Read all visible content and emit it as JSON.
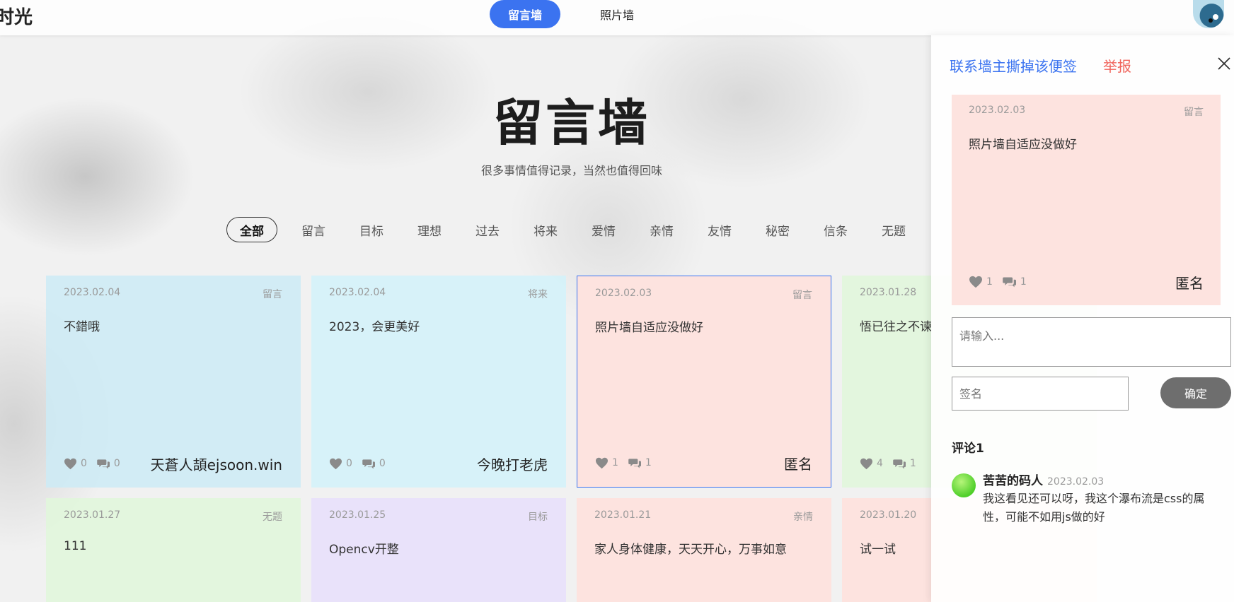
{
  "app": {
    "logo_text": "时光"
  },
  "nav": {
    "items": [
      {
        "label": "留言墙",
        "active": true
      },
      {
        "label": "照片墙",
        "active": false
      }
    ]
  },
  "hero": {
    "title": "留言墙",
    "subtitle": "很多事情值得记录，当然也值得回味"
  },
  "filters": {
    "selected": "全部",
    "items": [
      "全部",
      "留言",
      "目标",
      "理想",
      "过去",
      "将来",
      "爱情",
      "亲情",
      "友情",
      "秘密",
      "信条",
      "无题"
    ]
  },
  "cards": [
    {
      "date": "2023.02.04",
      "category": "留言",
      "message": "不錯哦",
      "likes": "0",
      "comments": "0",
      "signer": "天蒼人頡ejsoon.win",
      "color": "blue"
    },
    {
      "date": "2023.02.04",
      "category": "将来",
      "message": "2023，会更美好",
      "likes": "0",
      "comments": "0",
      "signer": "今晚打老虎",
      "color": "cyan"
    },
    {
      "date": "2023.02.03",
      "category": "留言",
      "message": "照片墙自适应没做好",
      "likes": "1",
      "comments": "1",
      "signer": "匿名",
      "color": "pink",
      "selected": true
    },
    {
      "date": "2023.01.28",
      "category": "",
      "message": "悟已往之不谏",
      "likes": "4",
      "comments": "1",
      "signer": "",
      "color": "green"
    },
    {
      "date": "2023.01.27",
      "category": "无题",
      "message": "111",
      "color": "green"
    },
    {
      "date": "2023.01.25",
      "category": "目标",
      "message": "Opencv开整",
      "color": "purple"
    },
    {
      "date": "2023.01.21",
      "category": "亲情",
      "message": "家人身体健康，天天开心，万事如意",
      "color": "pink"
    },
    {
      "date": "2023.01.20",
      "category": "",
      "message": "试一试",
      "color": "pink"
    }
  ],
  "drawer": {
    "tear_link": "联系墙主撕掉该便签",
    "report_link": "举报",
    "detail": {
      "date": "2023.02.03",
      "category": "留言",
      "message": "照片墙自适应没做好",
      "likes": "1",
      "comments": "1",
      "signer": "匿名"
    },
    "comment_placeholder": "请输入...",
    "sign_placeholder": "签名",
    "confirm_label": "确定",
    "comments_title": "评论1",
    "comment_list": [
      {
        "name": "苦苦的码人",
        "date": "2023.02.03",
        "text": "我这看见还可以呀，我这个瀑布流是css的属性，可能不如用js做的好"
      }
    ]
  },
  "colors": {
    "accent": "#3b73f0",
    "report": "#f0655d",
    "card_pink": "#fde3df",
    "card_blue": "#cdeaf5",
    "card_green": "#e1f6dc",
    "card_purple": "#e8e0fa"
  }
}
